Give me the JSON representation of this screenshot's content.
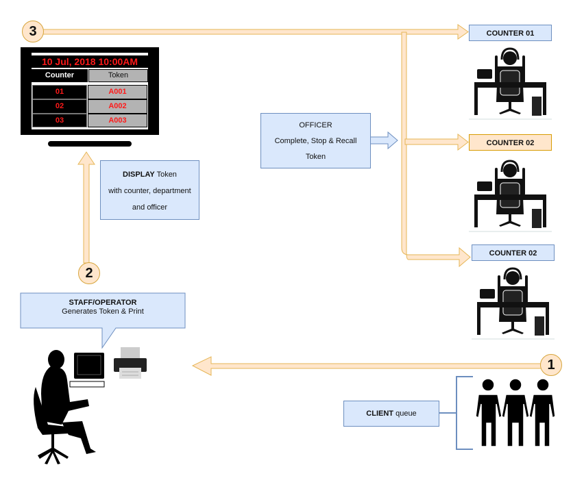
{
  "steps": {
    "step1": "1",
    "step2": "2",
    "step3": "3"
  },
  "display": {
    "datetime": "10 Jul, 2018 10:00AM",
    "headers": {
      "counter": "Counter",
      "token": "Token"
    },
    "rows": [
      {
        "counter": "01",
        "token": "A001"
      },
      {
        "counter": "02",
        "token": "A002"
      },
      {
        "counter": "03",
        "token": "A003"
      }
    ]
  },
  "display_note": {
    "title": "DISPLAY",
    "title_suffix": " Token",
    "line2": "with counter, department",
    "line3": "and officer"
  },
  "officer": {
    "title": "OFFICER",
    "line2": "Complete, Stop &  Recall",
    "line3": "Token"
  },
  "counters": [
    {
      "label": "COUNTER 01",
      "style": "blue"
    },
    {
      "label": "COUNTER 02",
      "style": "orange"
    },
    {
      "label": "COUNTER 02",
      "style": "blue"
    }
  ],
  "staff": {
    "title": "STAFF/OPERATOR",
    "subtitle": "Generates Token & Print"
  },
  "client": {
    "title": "CLIENT",
    "suffix": " queue"
  },
  "colors": {
    "arrow_fill": "#ffe6cc",
    "arrow_stroke": "#e6b656",
    "box_blue": "#dae8fc",
    "box_blue_border": "#6c8ebf",
    "display_red": "#ff1a1a"
  }
}
